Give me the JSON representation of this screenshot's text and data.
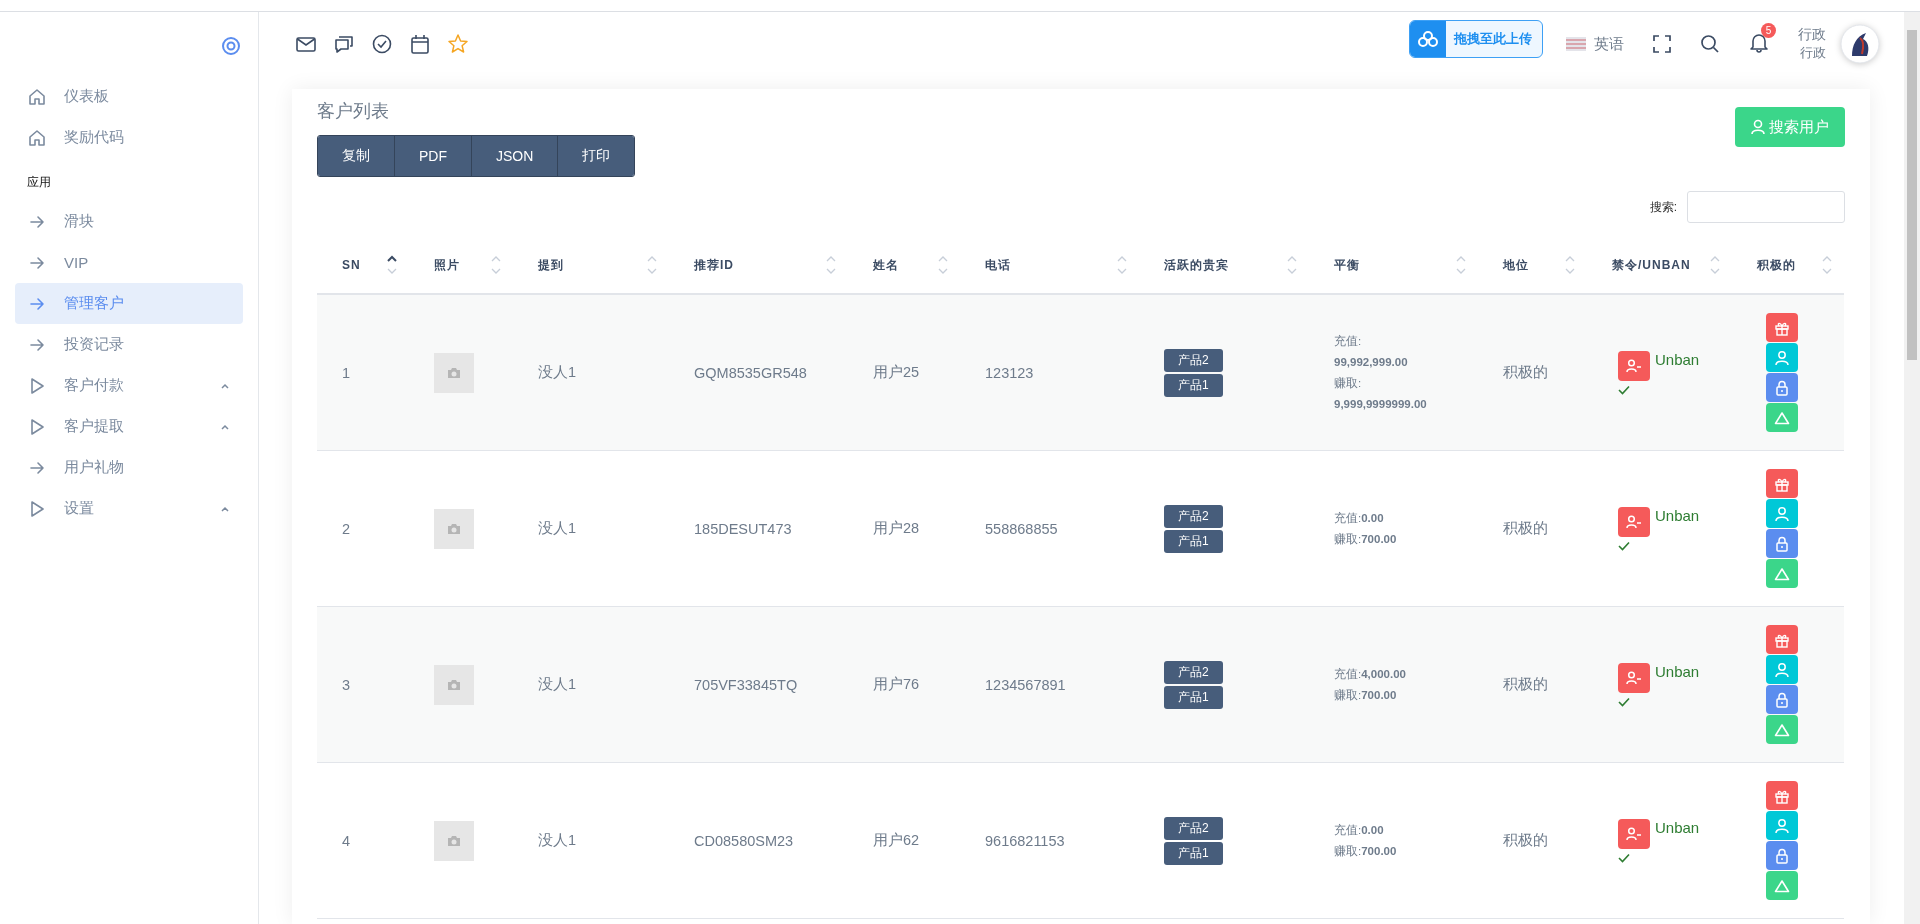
{
  "sidebar": {
    "items": [
      {
        "kind": "home",
        "label": "仪表板",
        "selected": false,
        "expandable": false
      },
      {
        "kind": "home",
        "label": "奖励代码",
        "selected": false,
        "expandable": false
      },
      {
        "kind": "heading",
        "label": "应用"
      },
      {
        "kind": "arrow",
        "label": "滑块",
        "selected": false,
        "expandable": false
      },
      {
        "kind": "arrow",
        "label": "VIP",
        "selected": false,
        "expandable": false
      },
      {
        "kind": "arrow",
        "label": "管理客户",
        "selected": true,
        "expandable": false
      },
      {
        "kind": "arrow",
        "label": "投资记录",
        "selected": false,
        "expandable": false
      },
      {
        "kind": "triangle",
        "label": "客户付款",
        "selected": false,
        "expandable": true
      },
      {
        "kind": "triangle",
        "label": "客户提取",
        "selected": false,
        "expandable": true
      },
      {
        "kind": "arrow",
        "label": "用户礼物",
        "selected": false,
        "expandable": false
      },
      {
        "kind": "triangle",
        "label": "设置",
        "selected": false,
        "expandable": true
      }
    ]
  },
  "topbar": {
    "upload_widget": "拖拽至此上传",
    "language": "英语",
    "notification_count": "5",
    "user": {
      "name": "行政",
      "role": "行政"
    }
  },
  "card": {
    "title": "客户列表",
    "export_buttons": [
      "复制",
      "PDF",
      "JSON",
      "打印"
    ],
    "search_user_button": "搜索用户",
    "search_label": "搜索:",
    "table": {
      "columns": [
        {
          "label": "SN",
          "sorted": true
        },
        {
          "label": "照片",
          "sorted": false
        },
        {
          "label": "提到",
          "sorted": false
        },
        {
          "label": "推荐ID",
          "sorted": false
        },
        {
          "label": "姓名",
          "sorted": false
        },
        {
          "label": "电话",
          "sorted": false
        },
        {
          "label": "活跃的贵宾",
          "sorted": false
        },
        {
          "label": "平衡",
          "sorted": false
        },
        {
          "label": "地位",
          "sorted": false
        },
        {
          "label": "禁令/UNBAN",
          "sorted": false
        },
        {
          "label": "积极的",
          "sorted": false
        }
      ],
      "rows": [
        {
          "sn": "1",
          "referral": "没人1",
          "referral_id": "GQM8535GR548",
          "name": "用户25",
          "phone": "123123",
          "products": [
            "产品2",
            "产品1"
          ],
          "balance": [
            {
              "label": "充值:",
              "value": "99,992,999.00"
            },
            {
              "label": "赚取:",
              "value": "9,999,9999999.00"
            }
          ],
          "status": "积极的",
          "ban_label": "Unban",
          "unbanned": true
        },
        {
          "sn": "2",
          "referral": "没人1",
          "referral_id": "185DESUT473",
          "name": "用户28",
          "phone": "558868855",
          "products": [
            "产品2",
            "产品1"
          ],
          "balance": [
            {
              "label": "充值:",
              "value": "0.00"
            },
            {
              "label": "赚取:",
              "value": "700.00"
            }
          ],
          "status": "积极的",
          "ban_label": "Unban",
          "unbanned": true
        },
        {
          "sn": "3",
          "referral": "没人1",
          "referral_id": "705VF33845TQ",
          "name": "用户76",
          "phone": "1234567891",
          "products": [
            "产品2",
            "产品1"
          ],
          "balance": [
            {
              "label": "充值:",
              "value": "4,000.00"
            },
            {
              "label": "赚取:",
              "value": "700.00"
            }
          ],
          "status": "积极的",
          "ban_label": "Unban",
          "unbanned": true
        },
        {
          "sn": "4",
          "referral": "没人1",
          "referral_id": "CD08580SM23",
          "name": "用户62",
          "phone": "9616821153",
          "products": [
            "产品2",
            "产品1"
          ],
          "balance": [
            {
              "label": "充值:",
              "value": "0.00"
            },
            {
              "label": "赚取:",
              "value": "700.00"
            }
          ],
          "status": "积极的",
          "ban_label": "Unban",
          "unbanned": true
        }
      ]
    }
  }
}
